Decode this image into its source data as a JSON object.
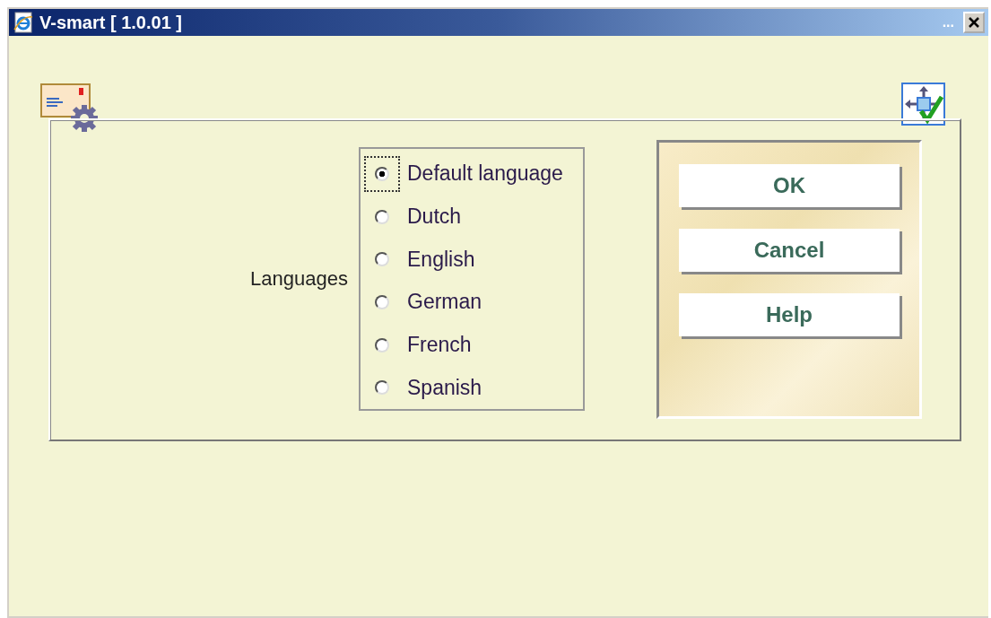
{
  "window": {
    "title": "V-smart [ 1.0.01 ]",
    "overflow_label": "..."
  },
  "form": {
    "label": "Languages",
    "options": [
      {
        "label": "Default language",
        "selected": true
      },
      {
        "label": "Dutch",
        "selected": false
      },
      {
        "label": "English",
        "selected": false
      },
      {
        "label": "German",
        "selected": false
      },
      {
        "label": "French",
        "selected": false
      },
      {
        "label": "Spanish",
        "selected": false
      }
    ]
  },
  "buttons": [
    "OK",
    "Cancel",
    "Help"
  ]
}
